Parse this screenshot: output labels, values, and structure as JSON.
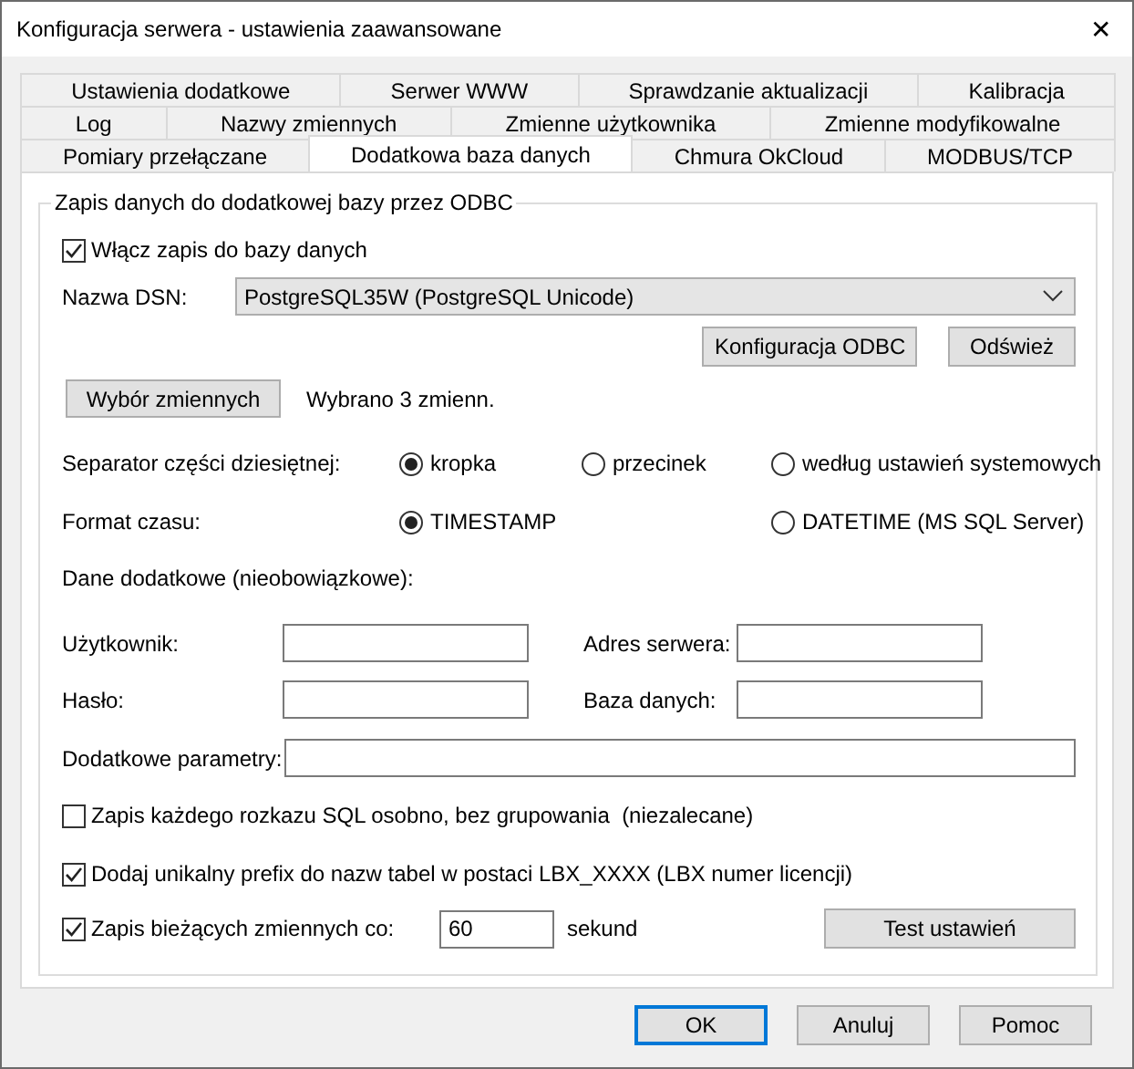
{
  "window": {
    "title": "Konfiguracja serwera - ustawienia zaawansowane",
    "close": "✕"
  },
  "tab_rows": [
    [
      {
        "label": "Ustawienia dodatkowe",
        "selected": false
      },
      {
        "label": "Serwer WWW",
        "selected": false
      },
      {
        "label": "Sprawdzanie aktualizacji",
        "selected": false
      },
      {
        "label": "Kalibracja",
        "selected": false
      }
    ],
    [
      {
        "label": "Log",
        "selected": false
      },
      {
        "label": "Nazwy zmiennych",
        "selected": false
      },
      {
        "label": "Zmienne użytkownika",
        "selected": false
      },
      {
        "label": "Zmienne modyfikowalne",
        "selected": false
      }
    ],
    [
      {
        "label": "Pomiary przełączane",
        "selected": false
      },
      {
        "label": "Dodatkowa baza danych",
        "selected": true
      },
      {
        "label": "Chmura OkCloud",
        "selected": false
      },
      {
        "label": "MODBUS/TCP",
        "selected": false
      }
    ]
  ],
  "group": {
    "title": "Zapis danych do dodatkowej bazy przez ODBC",
    "enable": {
      "label": "Włącz zapis do bazy danych",
      "checked": true
    },
    "dsn": {
      "label": "Nazwa DSN:",
      "value": "PostgreSQL35W (PostgreSQL Unicode)"
    },
    "dsn_buttons": [
      "Konfiguracja ODBC",
      "Odśwież"
    ],
    "variables": {
      "button": "Wybór zmiennych",
      "status": "Wybrano 3 zmienn."
    },
    "separator": {
      "label": "Separator części dziesiętnej:",
      "options": [
        {
          "label": "kropka",
          "selected": true
        },
        {
          "label": "przecinek",
          "selected": false
        },
        {
          "label": "według ustawień systemowych",
          "selected": false
        }
      ]
    },
    "time_format": {
      "label": "Format czasu:",
      "options": [
        {
          "label": "TIMESTAMP",
          "selected": true
        },
        {
          "label": "DATETIME (MS SQL Server)",
          "selected": false
        }
      ]
    },
    "extra_heading": "Dane dodatkowe (nieobowiązkowe):",
    "field_rows": [
      [
        {
          "label": "Użytkownik:"
        },
        {
          "label": "Adres serwera:"
        }
      ],
      [
        {
          "label": "Hasło:"
        },
        {
          "label": "Baza danych:"
        }
      ]
    ],
    "extra_params": {
      "label": "Dodatkowe parametry:"
    },
    "options": [
      {
        "label": "Zapis każdego rozkazu SQL osobno, bez grupowania  (niezalecane)",
        "checked": false
      },
      {
        "label": "Dodaj unikalny prefix do nazw tabel w postaci LBX_XXXX (LBX numer licencji)",
        "checked": true
      }
    ],
    "interval": {
      "label": "Zapis bieżących zmiennych co:",
      "checked": true,
      "value": "60",
      "unit": "sekund"
    },
    "test_button": "Test ustawień"
  },
  "footer_buttons": [
    {
      "label": "OK",
      "default": true
    },
    {
      "label": "Anuluj",
      "default": false
    },
    {
      "label": "Pomoc",
      "default": false
    }
  ]
}
